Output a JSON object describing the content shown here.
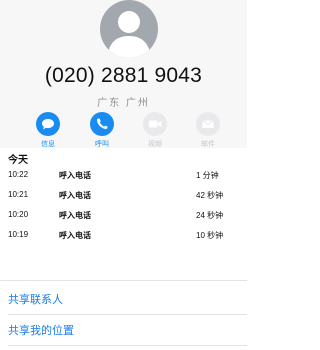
{
  "contact": {
    "phone": "(020) 2881 9043",
    "location": "广东 广州"
  },
  "actions": [
    {
      "label": "信息",
      "icon": "message-icon",
      "enabled": true
    },
    {
      "label": "呼叫",
      "icon": "phone-icon",
      "enabled": true
    },
    {
      "label": "视频",
      "icon": "video-icon",
      "enabled": false
    },
    {
      "label": "邮件",
      "icon": "mail-icon",
      "enabled": false
    }
  ],
  "recent": {
    "heading": "今天",
    "calls": [
      {
        "time": "10:22",
        "type": "呼入电话",
        "duration": "1 分钟"
      },
      {
        "time": "10:21",
        "type": "呼入电话",
        "duration": "42 秒钟"
      },
      {
        "time": "10:20",
        "type": "呼入电话",
        "duration": "24 秒钟"
      },
      {
        "time": "10:19",
        "type": "呼入电话",
        "duration": "10 秒钟"
      }
    ]
  },
  "links": {
    "share_contact": "共享联系人",
    "share_location": "共享我的位置"
  },
  "colors": {
    "accent": "#1a8cf1",
    "disabled": "#c7c7cc",
    "avatar": "#a3a7ae"
  }
}
